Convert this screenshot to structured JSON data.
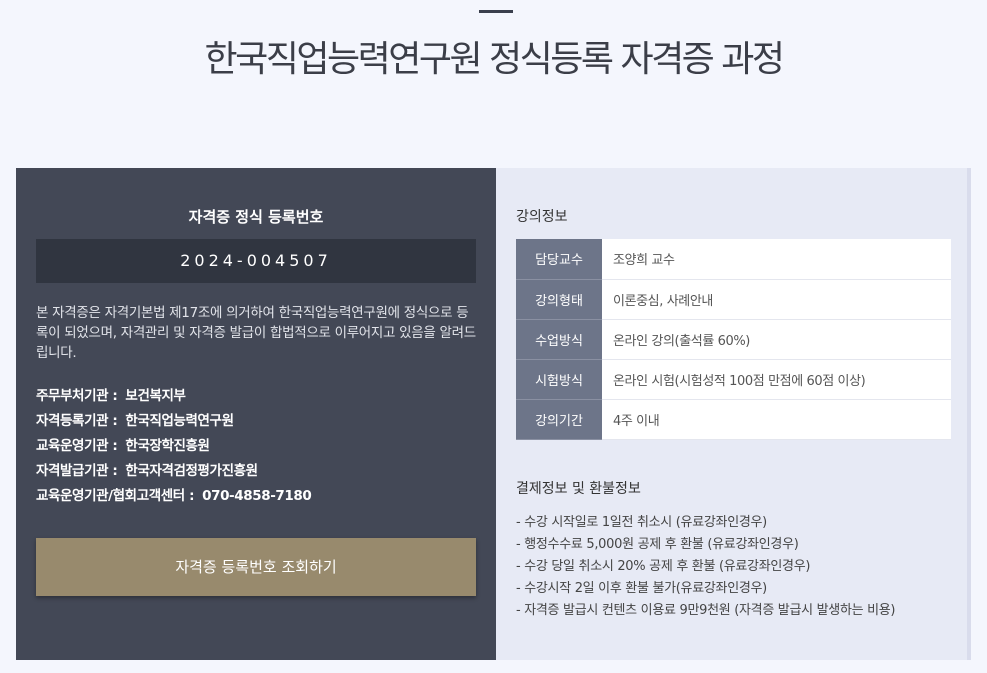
{
  "header": {
    "title": "한국직업능력연구원 정식등록 자격증 과정"
  },
  "registration": {
    "heading": "자격증 정식 등록번호",
    "number": "2024-004507",
    "description": "본 자격증은 자격기본법 제17조에 의거하여 한국직업능력연구원에 정식으로 등록이 되었으며, 자격관리 및 자격증 발급이 합법적으로 이루어지고 있음을 알려드립니다.",
    "orgs": [
      {
        "label": "주무부처기관 :",
        "value": "보건복지부"
      },
      {
        "label": "자격등록기관 :",
        "value": "한국직업능력연구원"
      },
      {
        "label": "교육운영기관 :",
        "value": "한국장학진흥원"
      },
      {
        "label": "자격발급기관 :",
        "value": "한국자격검정평가진흥원"
      },
      {
        "label": "교육운영기관/협회고객센터 :",
        "value": "070-4858-7180"
      }
    ],
    "lookup_button": "자격증 등록번호 조회하기"
  },
  "course": {
    "heading": "강의정보",
    "rows": [
      {
        "label": "담당교수",
        "value": "조양희 교수"
      },
      {
        "label": "강의형태",
        "value": "이론중심, 사례안내"
      },
      {
        "label": "수업방식",
        "value": "온라인 강의(출석률 60%)"
      },
      {
        "label": "시험방식",
        "value": "온라인 시험(시험성적 100점 만점에 60점 이상)"
      },
      {
        "label": "강의기간",
        "value": "4주 이내"
      }
    ]
  },
  "payment": {
    "heading": "결제정보 및 환불정보",
    "items": [
      "- 수강 시작일로 1일전 취소시 (유료강좌인경우)",
      "- 행정수수료 5,000원 공제 후 환불 (유료강좌인경우)",
      "- 수강 당일 취소시 20% 공제 후 환불 (유료강좌인경우)",
      "- 수강시작 2일 이후 환불 불가(유료강좌인경우)",
      "- 자격증 발급시 컨텐츠 이용료 9만9천원 (자격증 발급시 발생하는 비용)"
    ]
  }
}
